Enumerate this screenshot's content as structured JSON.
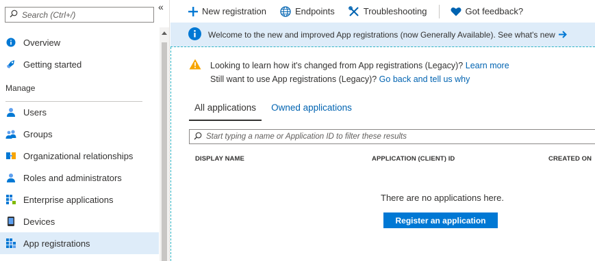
{
  "sidebar": {
    "search": {
      "placeholder": "Search (Ctrl+/)"
    },
    "collapse_label": "«",
    "items_top": [
      {
        "label": "Overview",
        "icon": "info-icon"
      },
      {
        "label": "Getting started",
        "icon": "rocket-icon"
      }
    ],
    "section_header": "Manage",
    "items_manage": [
      {
        "label": "Users",
        "icon": "user-icon"
      },
      {
        "label": "Groups",
        "icon": "group-icon"
      },
      {
        "label": "Organizational relationships",
        "icon": "org-relationships-icon"
      },
      {
        "label": "Roles and administrators",
        "icon": "roles-icon"
      },
      {
        "label": "Enterprise applications",
        "icon": "enterprise-apps-icon"
      },
      {
        "label": "Devices",
        "icon": "device-icon"
      },
      {
        "label": "App registrations",
        "icon": "app-registrations-icon",
        "active": true
      }
    ]
  },
  "toolbar": {
    "new_registration": "New registration",
    "endpoints": "Endpoints",
    "troubleshooting": "Troubleshooting",
    "feedback": "Got feedback?"
  },
  "banner": {
    "text": "Welcome to the new and improved App registrations (now Generally Available). See what's new"
  },
  "notice": {
    "line1_text": "Looking to learn how it's changed from App registrations (Legacy)?",
    "line1_link": "Learn more",
    "line2_text": "Still want to use App registrations (Legacy)?",
    "line2_link": "Go back and tell us why"
  },
  "tabs": [
    {
      "label": "All applications",
      "active": true
    },
    {
      "label": "Owned applications",
      "active": false
    }
  ],
  "filter": {
    "placeholder": "Start typing a name or Application ID to filter these results"
  },
  "table": {
    "columns": [
      "DISPLAY NAME",
      "APPLICATION (CLIENT) ID",
      "CREATED ON"
    ]
  },
  "empty_state": {
    "message": "There are no applications here.",
    "button": "Register an application"
  },
  "colors": {
    "accent": "#0078d4",
    "link": "#0063b1",
    "banner_bg": "#deecf9",
    "warning": "#f7a500",
    "active_nav_bg": "#deecf9"
  }
}
